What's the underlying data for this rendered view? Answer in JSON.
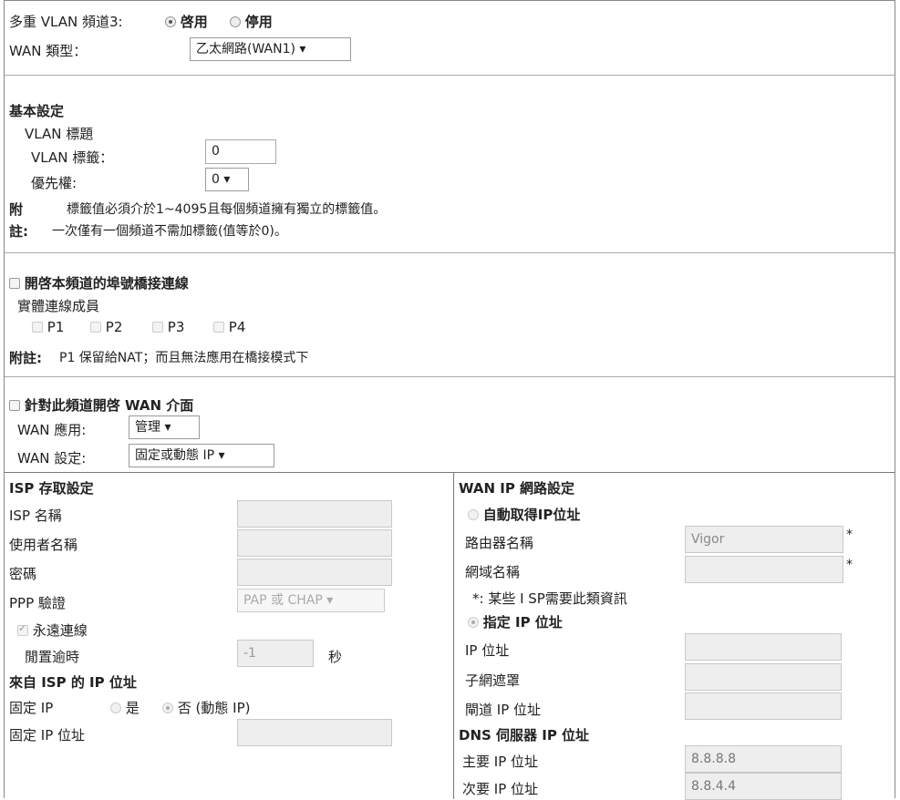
{
  "vlan": {
    "label": "多重 VLAN 頻道3:",
    "opt_enable": "啓用",
    "opt_disable": "停用",
    "selected": "enable"
  },
  "wan_type": {
    "label": "WAN 類型：",
    "value": "乙太網路(WAN1) ▾"
  },
  "basic": {
    "title": "基本設定",
    "vlan_header": "VLAN 標題",
    "tag_label": "VLAN 標籤：",
    "tag_value": "0",
    "priority_label": "優先權:",
    "priority_value": "0 ▾",
    "note_prefix1": "附",
    "note_text1": "標籤值必須介於1~4095且每個頻道擁有獨立的標籤值。",
    "note_prefix2": "註:",
    "note_text2": "一次僅有一個頻道不需加標籤(值等於0)。"
  },
  "bridge": {
    "title": "開啓本頻道的埠號橋接連線",
    "members_label": "實體連線成員",
    "ports": [
      "P1",
      "P2",
      "P3",
      "P4"
    ],
    "note_prefix": "附註:",
    "note_text": "P1 保留給NAT；而且無法應用在橋接模式下"
  },
  "wan_if": {
    "title": "針對此頻道開啓 WAN 介面",
    "app_label": "WAN 應用:",
    "app_value": "管理 ▾",
    "set_label": "WAN 設定:",
    "set_value": "固定或動態  IP ▾"
  },
  "isp": {
    "title": "ISP 存取設定",
    "name_label": "ISP 名稱",
    "user_label": "使用者名稱",
    "pass_label": "密碼",
    "ppp_label": "PPP 驗證",
    "ppp_value": "PAP 或  CHAP ▾",
    "always_label": "永遠連線",
    "idle_label": "閒置逾時",
    "idle_value": "-1",
    "idle_unit": "秒",
    "ip_from_title": "來自 ISP 的 IP 位址",
    "fixed_ip_label": "固定 IP",
    "fixed_yes": "是",
    "fixed_no": "否 (動態 IP)",
    "fixed_addr_label": "固定 IP 位址"
  },
  "wanip": {
    "title": "WAN IP 網路設定",
    "auto_label": "自動取得IP位址",
    "router_label": "路由器名稱",
    "router_value": "Vigor",
    "domain_label": "網域名稱",
    "asterisk": "*",
    "note": "*: 某些 I SP需要此類資訊",
    "specify_label": "指定 IP 位址",
    "ip_label": "IP 位址",
    "mask_label": "子網遮罩",
    "gw_label": "閘道 IP 位址",
    "dns_title": "DNS 伺服器 IP 位址",
    "primary_label": "主要 IP 位址",
    "primary_value": "8.8.8.8",
    "secondary_label": "次要 IP 位址",
    "secondary_value": "8.8.4.4"
  }
}
